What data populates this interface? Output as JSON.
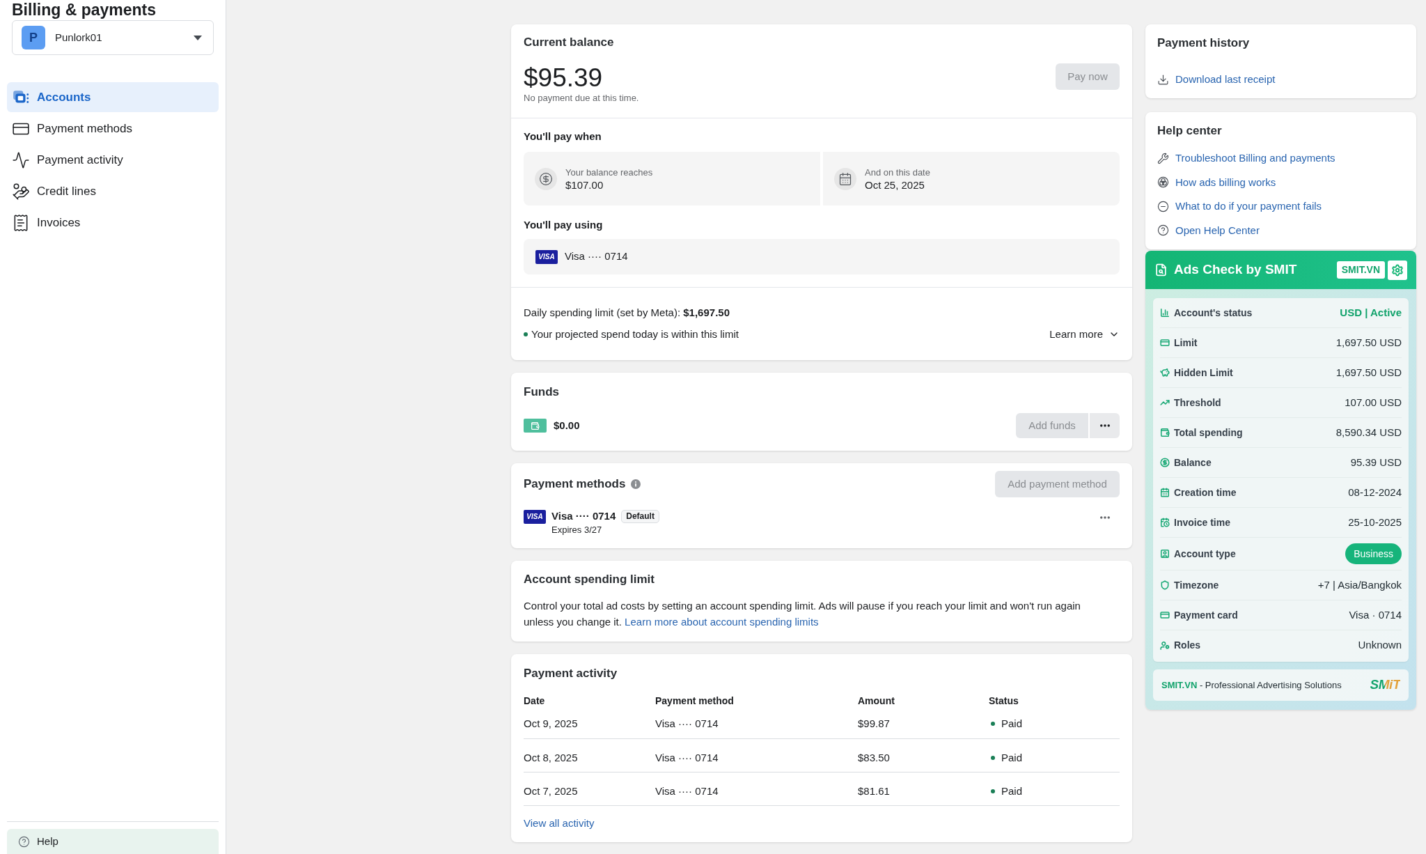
{
  "sidebar": {
    "title": "Billing & payments",
    "account_selector": {
      "avatar_letter": "P",
      "name": "Punlork01"
    },
    "items": [
      {
        "label": "Accounts",
        "selected": true
      },
      {
        "label": "Payment methods",
        "selected": false
      },
      {
        "label": "Payment activity",
        "selected": false
      },
      {
        "label": "Credit lines",
        "selected": false
      },
      {
        "label": "Invoices",
        "selected": false
      }
    ],
    "help": {
      "label": "Help"
    }
  },
  "current_balance": {
    "title": "Current balance",
    "amount": "$95.39",
    "note": "No payment due at this time.",
    "pay_button": {
      "label": "Pay now",
      "disabled": true
    },
    "pay_when": {
      "title": "You'll pay when",
      "conditions": [
        {
          "label": "Your balance reaches",
          "value": "$107.00"
        },
        {
          "label": "And on this date",
          "value": "Oct 25, 2025"
        }
      ]
    },
    "pay_using": {
      "title": "You'll pay using",
      "card_logo": "VISA",
      "card": "Visa ···· 0714"
    },
    "daily_limit": "Daily spending limit (set by Meta): **$1,697.50**",
    "projection": {
      "text": "Your projected spend today is within this limit",
      "color": "#1a7f56"
    },
    "learn_more": "Learn more"
  },
  "funds": {
    "title": "Funds",
    "amount": "$0.00",
    "add_button": {
      "label": "Add funds",
      "disabled": true
    }
  },
  "payment_methods": {
    "title": "Payment methods",
    "add_button": {
      "label": "Add payment method",
      "disabled": true
    },
    "methods": [
      {
        "card_logo": "VISA",
        "card": "Visa ···· 0714",
        "badge": "Default",
        "expires": "Expires 3/27"
      }
    ]
  },
  "spending_limit": {
    "title": "Account spending limit",
    "description": "Control your total ad costs by setting an account spending limit. Ads will pause if you reach your limit and won't run again unless you change it.",
    "link": "Learn more about account spending limits"
  },
  "payment_activity": {
    "title": "Payment activity",
    "columns": [
      "Date",
      "Payment method",
      "Amount",
      "Status"
    ],
    "rows": [
      {
        "date": "Oct 9, 2025",
        "method": "Visa ···· 0714",
        "amount": "$99.87",
        "status": "Paid",
        "color": "#1a7f56"
      },
      {
        "date": "Oct 8, 2025",
        "method": "Visa ···· 0714",
        "amount": "$83.50",
        "status": "Paid",
        "color": "#1a7f56"
      },
      {
        "date": "Oct 7, 2025",
        "method": "Visa ···· 0714",
        "amount": "$81.61",
        "status": "Paid",
        "color": "#1a7f56"
      }
    ],
    "view_all": "View all activity"
  },
  "payment_history": {
    "title": "Payment history",
    "link": "Download last receipt"
  },
  "help_center": {
    "title": "Help center",
    "links": [
      "Troubleshoot Billing and payments",
      "How ads billing works",
      "What to do if your payment fails",
      "Open Help Center"
    ]
  },
  "ads_check": {
    "title": "Ads Check by SMIT",
    "badge": "SMIT.VN",
    "rows": [
      {
        "label": "Account's status",
        "value": "USD | Active",
        "kind": "status"
      },
      {
        "label": "Limit",
        "value": "1,697.50 USD",
        "kind": "text"
      },
      {
        "label": "Hidden Limit",
        "value": "1,697.50 USD",
        "kind": "text"
      },
      {
        "label": "Threshold",
        "value": "107.00 USD",
        "kind": "text"
      },
      {
        "label": "Total spending",
        "value": "8,590.34 USD",
        "kind": "text"
      },
      {
        "label": "Balance",
        "value": "95.39 USD",
        "kind": "text"
      },
      {
        "label": "Creation time",
        "value": "08-12-2024",
        "kind": "text"
      },
      {
        "label": "Invoice time",
        "value": "25-10-2025",
        "kind": "text"
      },
      {
        "label": "Account type",
        "value": "Business",
        "kind": "badge"
      },
      {
        "label": "Timezone",
        "value": "+7 | Asia/Bangkok",
        "kind": "text"
      },
      {
        "label": "Payment card",
        "value": "Visa · 0714",
        "kind": "text"
      },
      {
        "label": "Roles",
        "value": "Unknown",
        "kind": "text"
      }
    ],
    "footer": {
      "text": "**SMIT.VN** - Professional Advertising Solutions",
      "logo": "SMiT"
    }
  }
}
